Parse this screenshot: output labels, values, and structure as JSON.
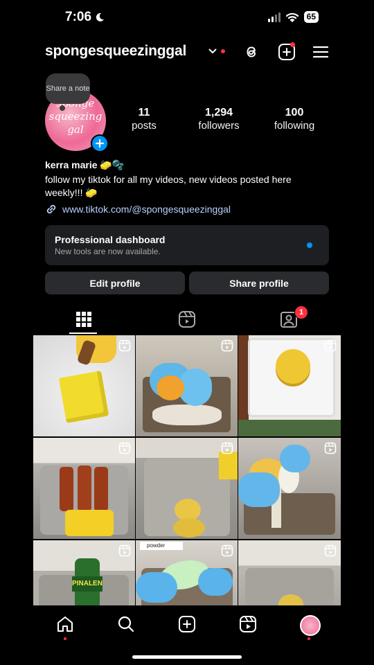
{
  "status": {
    "time": "7:06",
    "battery": "65"
  },
  "header": {
    "username": "spongesqueezinggal"
  },
  "profile": {
    "avatar_text": "sponge squeezing gal",
    "note": "Share a note",
    "stats": [
      {
        "value": "11",
        "label": "posts"
      },
      {
        "value": "1,294",
        "label": "followers"
      },
      {
        "value": "100",
        "label": "following"
      }
    ],
    "name": "kerra marie 🧽🫧",
    "bio": "follow my tiktok for all my videos, new videos posted here weekly!!! 🧽",
    "link": "www.tiktok.com/@spongesqueezinggal"
  },
  "dashboard": {
    "title": "Professional dashboard",
    "subtitle": "New tools are now available."
  },
  "buttons": {
    "edit": "Edit profile",
    "share": "Share profile"
  },
  "tabs": {
    "tagged_badge": "1"
  },
  "grid": {
    "label_powder": "powder",
    "label_bottle": "PINALEN"
  },
  "colors": {
    "accent_blue": "#0095f6",
    "notification_red": "#ff3040",
    "card_bg": "#1e1f22",
    "button_bg": "#2a2b2e"
  }
}
